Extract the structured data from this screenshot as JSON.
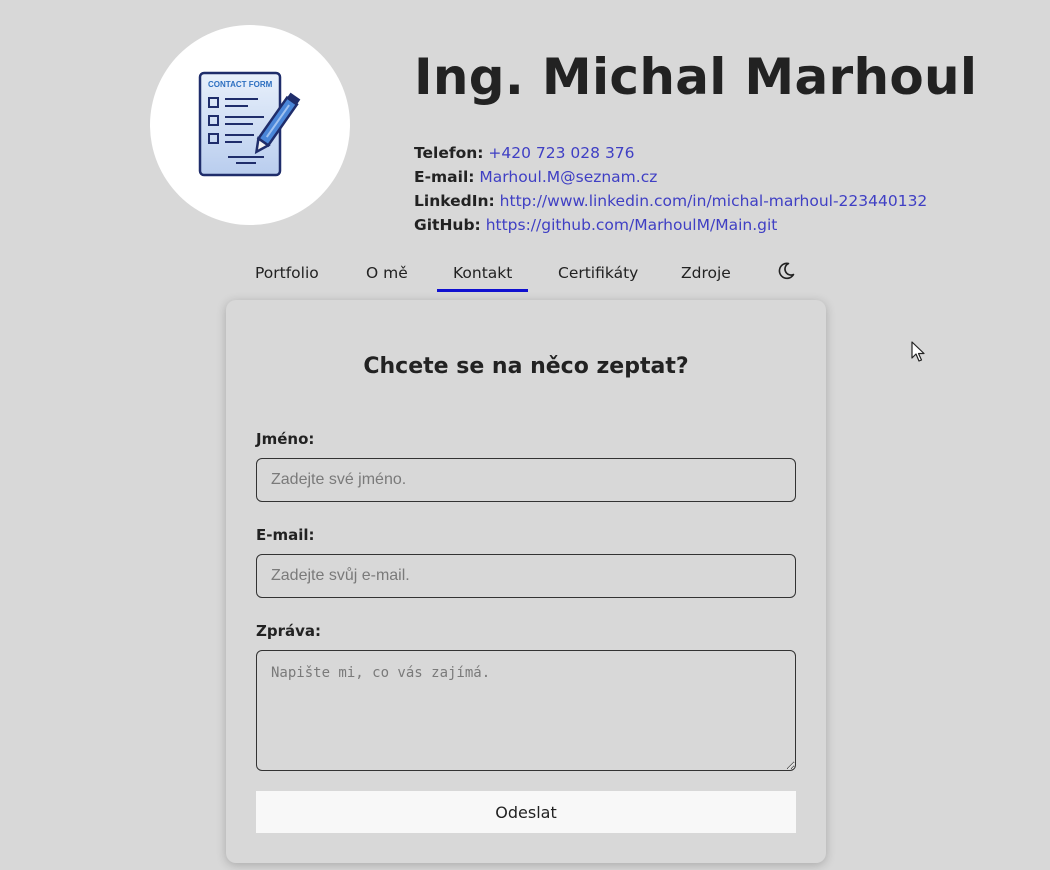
{
  "header": {
    "name": "Ing. Michal Marhoul",
    "logo_icon": "contact-form-icon",
    "logo_text": "CONTACT FORM",
    "contacts": {
      "phone_label": "Telefon:",
      "phone_value": "+420 723 028 376",
      "email_label": "E-mail:",
      "email_value": "Marhoul.M@seznam.cz",
      "linkedin_label": "LinkedIn:",
      "linkedin_value": "http://www.linkedin.com/in/michal-marhoul-223440132",
      "github_label": "GitHub:",
      "github_value": "https://github.com/MarhoulM/Main.git"
    }
  },
  "nav": {
    "items": [
      {
        "label": "Portfolio"
      },
      {
        "label": "O mě"
      },
      {
        "label": "Kontakt",
        "active": true
      },
      {
        "label": "Certifikáty"
      },
      {
        "label": "Zdroje"
      }
    ],
    "theme_icon": "moon-icon"
  },
  "form": {
    "title": "Chcete se na něco zeptat?",
    "name_label": "Jméno:",
    "name_placeholder": "Zadejte své jméno.",
    "email_label": "E-mail:",
    "email_placeholder": "Zadejte svůj e-mail.",
    "message_label": "Zpráva:",
    "message_placeholder": "Napište mi, co vás zajímá.",
    "submit_label": "Odeslat"
  },
  "colors": {
    "background": "#d8d8d8",
    "link": "#3f3fc4",
    "active_underline": "#1010d0",
    "avatar_bg": "#ffffff"
  }
}
